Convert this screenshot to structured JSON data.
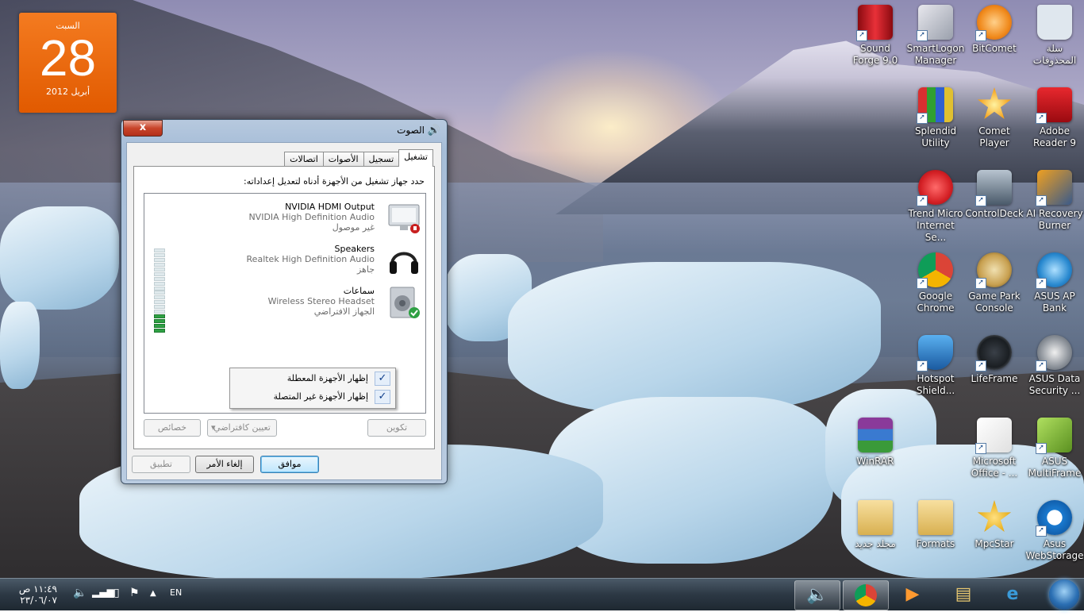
{
  "calendar": {
    "day_name": "السبت",
    "date": "28",
    "month_year": "أبريل 2012"
  },
  "desktop_icons": [
    {
      "label": "سلة المحذوفات",
      "icon": "recycle-bin-icon",
      "color": "#dfe7ee"
    },
    {
      "label": "BitComet",
      "icon": "bitcomet-icon",
      "color": "#f08a1c"
    },
    {
      "label": "SmartLogon Manager",
      "icon": "smartlogon-icon",
      "color": "#c0c4cc"
    },
    {
      "label": "Sound Forge 9.0",
      "icon": "sound-forge-icon",
      "color": "#d0202a"
    },
    {
      "label": "Adobe Reader 9",
      "icon": "adobe-reader-icon",
      "color": "#c8141c"
    },
    {
      "label": "Comet Player",
      "icon": "comet-player-icon",
      "color": "#f5a623"
    },
    {
      "label": "Splendid Utility",
      "icon": "splendid-utility-icon",
      "color": "#5a9a3a"
    },
    {
      "label": "AI Recovery Burner",
      "icon": "ai-recovery-burner-icon",
      "color": "#3a5a8a"
    },
    {
      "label": "ControlDeck",
      "icon": "controldeck-icon",
      "color": "#5a6a7a"
    },
    {
      "label": "Trend Micro Internet Se...",
      "icon": "trend-micro-icon",
      "color": "#d42025"
    },
    {
      "label": "ASUS AP Bank",
      "icon": "asus-ap-bank-icon",
      "color": "#2a8ad0"
    },
    {
      "label": "Game Park Console",
      "icon": "game-park-icon",
      "color": "#c8a050"
    },
    {
      "label": "Google Chrome",
      "icon": "chrome-icon",
      "color": "#3a8a3a"
    },
    {
      "label": "ASUS Data Security ...",
      "icon": "asus-data-security-icon",
      "color": "#8a9098"
    },
    {
      "label": "LifeFrame",
      "icon": "lifeframe-icon",
      "color": "#5a6068"
    },
    {
      "label": "Hotspot Shield...",
      "icon": "hotspot-shield-icon",
      "color": "#2a70c0"
    },
    {
      "label": "ASUS MultiFrame",
      "icon": "asus-multiframe-icon",
      "color": "#7ab030"
    },
    {
      "label": "Microsoft Office - ...",
      "icon": "ms-office-icon",
      "color": "#e06020"
    },
    {
      "label": "WinRAR",
      "icon": "winrar-icon",
      "color": "#7a3a8a"
    },
    {
      "label": "Asus WebStorage",
      "icon": "asus-webstorage-icon",
      "color": "#1a7ad0"
    },
    {
      "label": "MpcStar",
      "icon": "mpcstar-icon",
      "color": "#e8b020"
    },
    {
      "label": "Formats",
      "icon": "folder-icon",
      "color": "#e8c870"
    },
    {
      "label": "مجلد جديد",
      "icon": "folder-icon",
      "color": "#e8c870"
    }
  ],
  "dialog": {
    "title": "الصوت",
    "close": "x",
    "tabs": [
      "تشغيل",
      "تسجيل",
      "الأصوات",
      "اتصالات"
    ],
    "instruction": "حدد جهاز تشغيل من الأجهزة أدناه لتعديل إعداداته:",
    "devices": [
      {
        "name": "NVIDIA HDMI Output",
        "driver": "NVIDIA High Definition Audio",
        "status": "غير موصول",
        "icon": "monitor-icon"
      },
      {
        "name": "Speakers",
        "driver": "Realtek High Definition Audio",
        "status": "جاهز",
        "icon": "headphones-icon"
      },
      {
        "name": "سماعات",
        "driver": "Wireless Stereo Headset",
        "status": "الجهاز الافتراضي",
        "icon": "speaker-icon"
      }
    ],
    "context_menu": [
      {
        "label": "إظهار الأجهزة المعطلة",
        "checked": "✓"
      },
      {
        "label": "إظهار الأجهزة غير المتصلة",
        "checked": "✓"
      }
    ],
    "configure": "تكوين",
    "set_default": "تعيين كافتراضي",
    "properties": "خصائص",
    "ok": "موافق",
    "cancel": "إلغاء الأمر",
    "apply": "تطبيق"
  },
  "taskbar": {
    "time": "١١:٤٩ ص",
    "date": "٢٣/٠٦/٠٧",
    "language": "EN"
  }
}
